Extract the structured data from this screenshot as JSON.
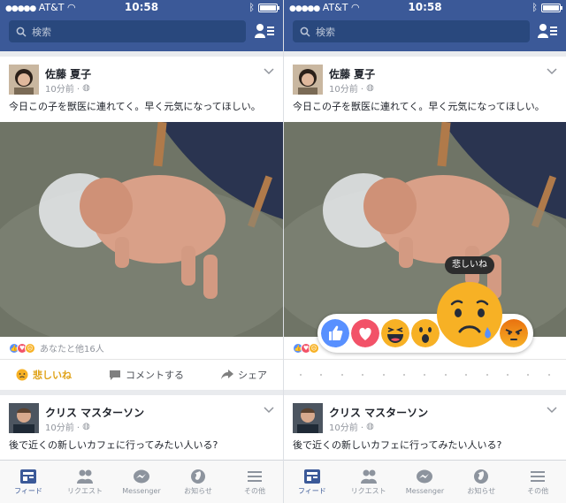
{
  "status": {
    "carrier": "AT&T",
    "time": "10:58"
  },
  "search": {
    "placeholder": "検索"
  },
  "post1": {
    "author": "佐藤 夏子",
    "time": "10分前 ·",
    "text": "今日この子を獣医に連れてく。早く元気になってほしい。",
    "likes_text": "あなたと他16人"
  },
  "actions": {
    "sad": "悲しいね",
    "comment": "コメントする",
    "share": "シェア"
  },
  "reactions": {
    "tooltip": "悲しいね",
    "items": [
      "like-icon",
      "love-icon",
      "haha-icon",
      "wow-icon",
      "sad-icon",
      "angry-icon"
    ]
  },
  "post2": {
    "author": "クリス マスターソン",
    "time": "10分前 ·",
    "text": "後で近くの新しいカフェに行ってみたい人いる?"
  },
  "tabs": [
    {
      "label": "フィード",
      "icon": "news-feed-icon"
    },
    {
      "label": "リクエスト",
      "icon": "friend-requests-icon"
    },
    {
      "label": "Messenger",
      "icon": "messenger-icon"
    },
    {
      "label": "お知らせ",
      "icon": "globe-icon"
    },
    {
      "label": "その他",
      "icon": "menu-icon"
    }
  ],
  "colors": {
    "brand": "#3b5998",
    "sad": "#f7b125",
    "love": "#f25268",
    "like": "#5890ff",
    "angry": "#e9710f"
  }
}
